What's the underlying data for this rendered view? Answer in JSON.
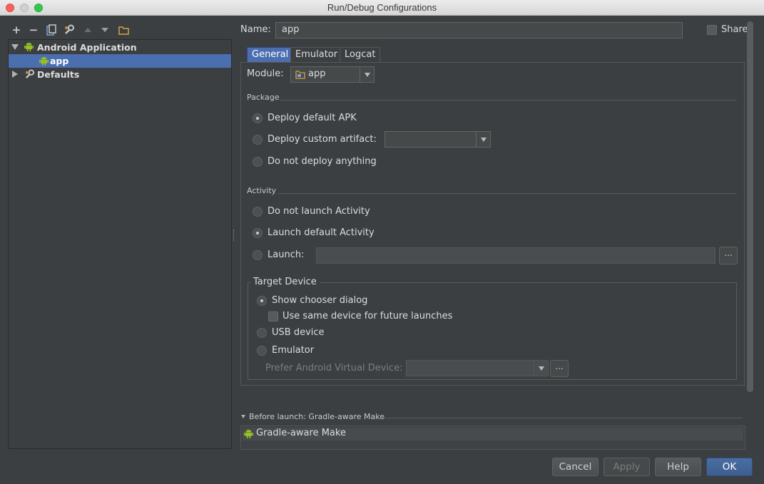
{
  "window": {
    "title": "Run/Debug Configurations"
  },
  "toolbar": {
    "add": "+",
    "remove": "−"
  },
  "tree": {
    "groups": [
      {
        "label": "Android Application",
        "children": [
          {
            "label": "app"
          }
        ]
      },
      {
        "label": "Defaults"
      }
    ]
  },
  "name_field": {
    "label": "Name:",
    "value": "app"
  },
  "share": {
    "label": "Share"
  },
  "tabs": [
    {
      "label": "General"
    },
    {
      "label": "Emulator"
    },
    {
      "label": "Logcat"
    }
  ],
  "module": {
    "label": "Module:",
    "value": "app"
  },
  "package": {
    "title": "Package",
    "options": [
      {
        "label": "Deploy default APK",
        "selected": true
      },
      {
        "label": "Deploy custom artifact:",
        "selected": false
      },
      {
        "label": "Do not deploy anything",
        "selected": false
      }
    ]
  },
  "activity": {
    "title": "Activity",
    "options": [
      {
        "label": "Do not launch Activity",
        "selected": false
      },
      {
        "label": "Launch default Activity",
        "selected": true
      },
      {
        "label": "Launch:",
        "selected": false
      }
    ],
    "browse": "..."
  },
  "target_device": {
    "title": "Target Device",
    "show_chooser": "Show chooser dialog",
    "use_same_device": "Use same device for future launches",
    "usb": "USB device",
    "emulator": "Emulator",
    "prefer_avd": "Prefer Android Virtual Device:",
    "browse": "..."
  },
  "before_launch": {
    "title": "Before launch: Gradle-aware Make",
    "item": "Gradle-aware Make"
  },
  "buttons": {
    "cancel": "Cancel",
    "apply": "Apply",
    "help": "Help",
    "ok": "OK"
  },
  "colors": {
    "background": "#3c3f41",
    "selection": "#4b6eaf",
    "android_green": "#97c024"
  }
}
